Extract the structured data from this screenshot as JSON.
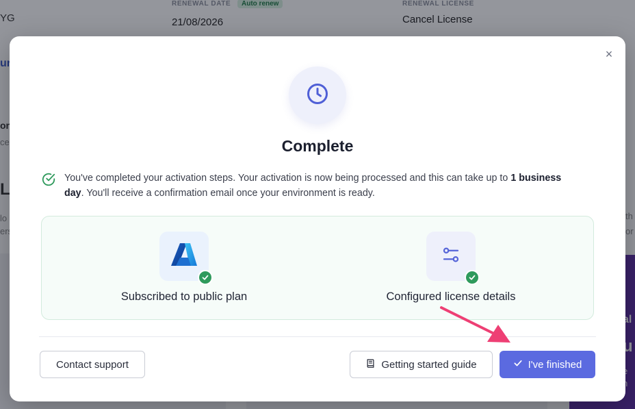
{
  "background": {
    "renewal_date_label": "RENEWAL DATE",
    "renewal_date_value": "21/08/2026",
    "auto_renew_badge": "Auto renew",
    "renewal_license_label": "RENEWAL LICENSE",
    "cancel_license": "Cancel License",
    "left_fragment_top": "YG",
    "left_fragment_link": "ur",
    "left_fragment_on": "on",
    "left_fragment_ce": "ce",
    "left_fragment_li": "Li",
    "left_fragment_lo": "lo",
    "left_fragment_er": "ers",
    "left_fragment_u": "u",
    "left_fragment_at": "at",
    "left_fragment_ng": "ng",
    "right_fragment_th": "th",
    "right_fragment_or": "or",
    "right_fragment_al": "al",
    "right_fragment_u": "u",
    "right_fragment_e": "e",
    "right_fragment_n": "n"
  },
  "modal": {
    "title": "Complete",
    "close_glyph": "×",
    "notice_part1": "You've completed your activation steps. Your activation is now being processed and this can take up to ",
    "notice_bold1": "1 business day",
    "notice_part2": ". You'll receive a confirmation email once your environment is ready.",
    "steps": [
      {
        "label": "Subscribed to public plan",
        "icon": "azure-logo-icon",
        "status": "done"
      },
      {
        "label": "Configured license details",
        "icon": "sliders-icon",
        "status": "done"
      }
    ],
    "buttons": {
      "contact_support": "Contact support",
      "getting_started_guide": "Getting started guide",
      "finished": "I've finished"
    }
  },
  "colors": {
    "primary": "#5b6ae0",
    "success": "#2f9a5c",
    "annotation_arrow": "#ee3f74"
  }
}
